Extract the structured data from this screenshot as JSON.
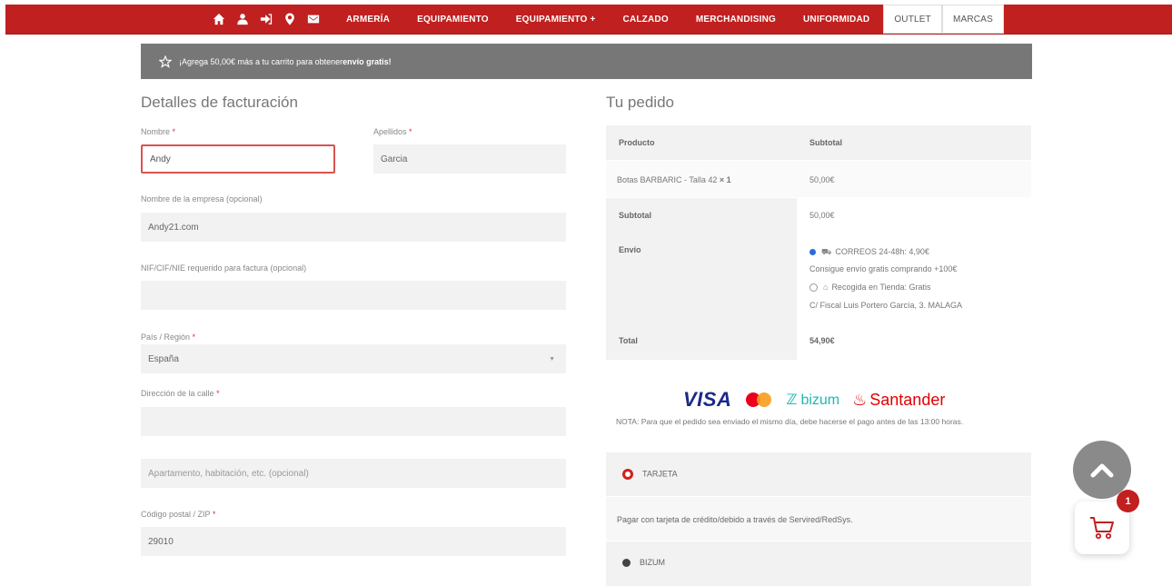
{
  "nav": {
    "icons": [
      "home-icon",
      "user-icon",
      "login-icon",
      "location-icon",
      "mail-icon"
    ],
    "items": [
      "ARMERÍA",
      "EQUIPAMIENTO",
      "EQUIPAMIENTO +",
      "CALZADO",
      "MERCHANDISING",
      "UNIFORMIDAD"
    ],
    "light_items": [
      "OUTLET",
      "MARCAS"
    ]
  },
  "notice": {
    "prefix": "¡Agrega 50,00€ más a tu carrito para obtener ",
    "bold": "envío gratis!"
  },
  "billing": {
    "title": "Detalles de facturación",
    "nombre_label": "Nombre",
    "nombre_value": "Andy",
    "apellidos_label": "Apellidos",
    "apellidos_value": "Garcia",
    "empresa_label": "Nombre de la empresa (opcional)",
    "empresa_value": "Andy21.com",
    "nif_label": "NIF/CIF/NIE requerido para factura (opcional)",
    "nif_value": "",
    "pais_label": "País / Región",
    "pais_value": "España",
    "calle_label": "Dirección de la calle",
    "calle_value": "",
    "apartamento_placeholder": "Apartamento, habitación, etc. (opcional)",
    "cp_label": "Código postal / ZIP",
    "cp_value": "29010",
    "required_mark": "*"
  },
  "order": {
    "title": "Tu pedido",
    "col_producto": "Producto",
    "col_subtotal": "Subtotal",
    "product_name": "Botas BARBARIC - Talla 42",
    "product_qty": "× 1",
    "product_price": "50,00€",
    "subtotal_label": "Subtotal",
    "subtotal_value": "50,00€",
    "envio_label": "Envío",
    "shipping_option1": "CORREOS 24-48h: 4,90€",
    "shipping_note": "Consigue envío gratis comprando +100€",
    "shipping_option2": "Recogida en Tienda: Gratis",
    "shipping_address": "C/ Fiscal Luis Portero García, 3. MALAGA",
    "total_label": "Total",
    "total_value": "54,90€"
  },
  "payment": {
    "visa": "VISA",
    "bizum": "bizum",
    "santander": "Santander",
    "nota": "NOTA: Para que el pedido sea enviado el mismo día, debe hacerse el pago antes de las 13:00 horas.",
    "tarjeta_label": "TARJETA",
    "tarjeta_desc": "Pagar con tarjeta de crédito/debido a través de Servired/RedSys.",
    "bizum_label": "BIZUM"
  },
  "cart": {
    "count": "1"
  },
  "colors": {
    "brand_red": "#c0201f",
    "notice_gray": "#777777",
    "field_bg": "#f2f2f2"
  }
}
